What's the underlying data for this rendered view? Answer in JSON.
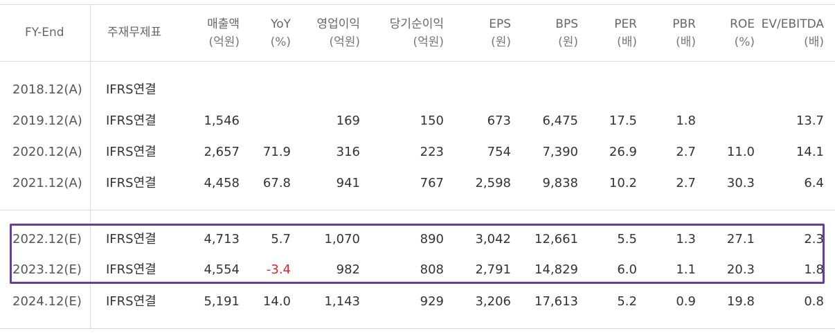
{
  "header": {
    "fy_end": "FY-End",
    "type": "주재무제표",
    "columns": [
      {
        "l1": "매출액",
        "l2": "(억원)"
      },
      {
        "l1": "YoY",
        "l2": "(%)"
      },
      {
        "l1": "영업이익",
        "l2": "(억원)"
      },
      {
        "l1": "당기순이익",
        "l2": "(억원)"
      },
      {
        "l1": "EPS",
        "l2": "(원)"
      },
      {
        "l1": "BPS",
        "l2": "(원)"
      },
      {
        "l1": "PER",
        "l2": "(배)"
      },
      {
        "l1": "PBR",
        "l2": "(배)"
      },
      {
        "l1": "ROE",
        "l2": "(%)"
      },
      {
        "l1": "EV/EBITDA",
        "l2": "(배)"
      }
    ]
  },
  "rows": [
    {
      "fy": "2018.12(A)",
      "type": "IFRS연결",
      "v": [
        "",
        "",
        "",
        "",
        "",
        "",
        "",
        "",
        "",
        ""
      ]
    },
    {
      "fy": "2019.12(A)",
      "type": "IFRS연결",
      "v": [
        "1,546",
        "",
        "169",
        "150",
        "673",
        "6,475",
        "17.5",
        "1.8",
        "",
        "13.7"
      ]
    },
    {
      "fy": "2020.12(A)",
      "type": "IFRS연결",
      "v": [
        "2,657",
        "71.9",
        "316",
        "223",
        "754",
        "7,390",
        "26.9",
        "2.7",
        "11.0",
        "14.1"
      ]
    },
    {
      "fy": "2021.12(A)",
      "type": "IFRS연결",
      "v": [
        "4,458",
        "67.8",
        "941",
        "767",
        "2,598",
        "9,838",
        "10.2",
        "2.7",
        "30.3",
        "6.4"
      ]
    },
    {
      "fy": "2022.12(E)",
      "type": "IFRS연결",
      "v": [
        "4,713",
        "5.7",
        "1,070",
        "890",
        "3,042",
        "12,661",
        "5.5",
        "1.3",
        "27.1",
        "2.3"
      ]
    },
    {
      "fy": "2023.12(E)",
      "type": "IFRS연결",
      "v": [
        "4,554",
        "-3.4",
        "982",
        "808",
        "2,791",
        "14,829",
        "6.0",
        "1.1",
        "20.3",
        "1.8"
      ]
    },
    {
      "fy": "2024.12(E)",
      "type": "IFRS연결",
      "v": [
        "5,191",
        "14.0",
        "1,143",
        "929",
        "3,206",
        "17,613",
        "5.2",
        "0.9",
        "19.8",
        "0.8"
      ]
    }
  ],
  "colors": {
    "negative": "#e0232b",
    "highlight_border": "#6a3d9a"
  }
}
